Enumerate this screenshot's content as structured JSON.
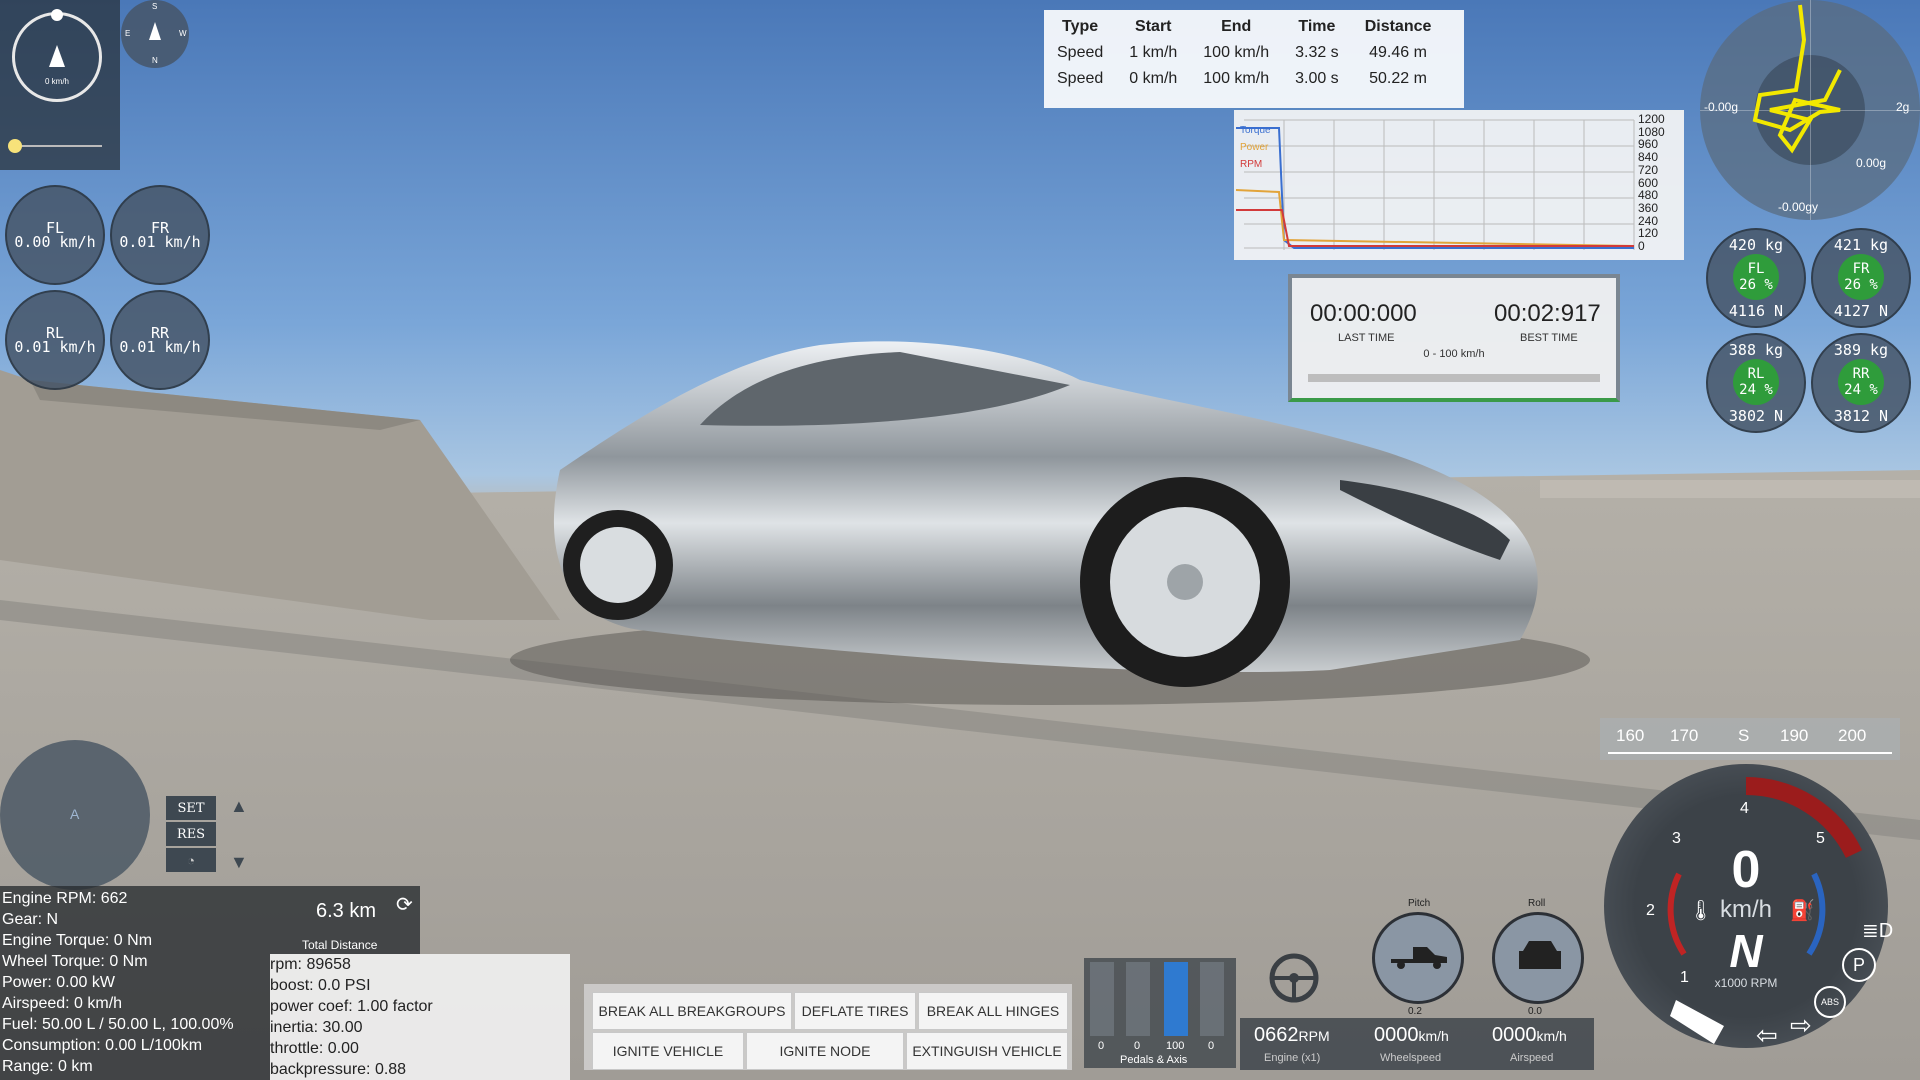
{
  "minimap": {
    "speed_label": "0 km/h",
    "compass": {
      "s": "S",
      "e": "E",
      "w": "W",
      "n": "N"
    }
  },
  "wheels": [
    {
      "name": "FL",
      "speed": "0.00 km/h"
    },
    {
      "name": "FR",
      "speed": "0.01 km/h"
    },
    {
      "name": "RL",
      "speed": "0.01 km/h"
    },
    {
      "name": "RR",
      "speed": "0.01 km/h"
    }
  ],
  "accel_table": {
    "headers": [
      "Type",
      "Start",
      "End",
      "Time",
      "Distance"
    ],
    "rows": [
      [
        "Speed",
        "1 km/h",
        "100 km/h",
        "3.32 s",
        "49.46 m"
      ],
      [
        "Speed",
        "0 km/h",
        "100 km/h",
        "3.00 s",
        "50.22 m"
      ]
    ]
  },
  "torque_graph": {
    "legend": [
      "Torque",
      "Power",
      "RPM"
    ],
    "legend_colors": [
      "#3a6fd0",
      "#e2a43a",
      "#d23a3a"
    ],
    "y_ticks": [
      "1200",
      "1080",
      "960",
      "840",
      "720",
      "600",
      "480",
      "360",
      "240",
      "120",
      "0"
    ]
  },
  "timer": {
    "last_time": "00:00:000",
    "last_label": "LAST TIME",
    "best_time": "00:02:917",
    "best_label": "BEST TIME",
    "range": "0 - 100 km/h"
  },
  "gforce": {
    "left": "-0.00g",
    "right": "2g",
    "inner_right": "0.00g",
    "bottom": "-0.00gy"
  },
  "tire_loads": [
    {
      "corner": "FL",
      "kg": "420 kg",
      "pct": "26 %",
      "n": "4116 N"
    },
    {
      "corner": "FR",
      "kg": "421 kg",
      "pct": "26 %",
      "n": "4127 N"
    },
    {
      "corner": "RL",
      "kg": "388 kg",
      "pct": "24 %",
      "n": "3802 N"
    },
    {
      "corner": "RR",
      "kg": "389 kg",
      "pct": "24 %",
      "n": "3812 N"
    }
  ],
  "cruise": {
    "set": "SET",
    "res": "RES"
  },
  "radar": {
    "label": "A"
  },
  "vehicle_info": {
    "lines": [
      "Engine RPM: 662",
      "Gear: N",
      "Engine Torque: 0 Nm",
      "Wheel Torque: 0 Nm",
      "Power: 0.00 kW",
      "Airspeed: 0 km/h",
      "Fuel: 50.00 L / 50.00 L, 100.00%",
      "Consumption: 0.00 L/100km",
      "Range: 0 km"
    ],
    "distance": "6.3 km",
    "distance_label": "Total Distance"
  },
  "engine_debug": [
    "rpm: 89658",
    "boost: 0.0 PSI",
    "power coef: 1.00 factor",
    "inertia: 30.00",
    "throttle: 0.00",
    "backpressure: 0.88"
  ],
  "buttons": {
    "break_groups": "BREAK ALL BREAKGROUPS",
    "deflate": "DEFLATE TIRES",
    "break_hinges": "BREAK ALL HINGES",
    "ignite_vehicle": "IGNITE VEHICLE",
    "ignite_node": "IGNITE NODE",
    "extinguish": "EXTINGUISH VEHICLE"
  },
  "pedals": {
    "values": [
      "0",
      "0",
      "100",
      "0"
    ],
    "label": "Pedals & Axis",
    "levels": [
      0,
      0,
      1,
      0
    ]
  },
  "readouts": {
    "rpm_value": "0662",
    "rpm_unit": "RPM",
    "rpm_label": "Engine (x1)",
    "wheel_value": "0000",
    "wheel_unit": "km/h",
    "wheel_label": "Wheelspeed",
    "air_value": "0000",
    "air_unit": "km/h",
    "air_label": "Airspeed"
  },
  "attitude": {
    "pitch_label": "Pitch",
    "roll_label": "Roll",
    "pitch_value": "0.2",
    "roll_value": "0.0"
  },
  "speed_tape": {
    "ticks": [
      "160",
      "170",
      "S",
      "190",
      "200"
    ]
  },
  "dashboard": {
    "speed": "0",
    "unit": "km/h",
    "gear": "N",
    "rpm_label": "x1000 RPM",
    "rpm_marks": [
      "1",
      "2",
      "3",
      "4",
      "5"
    ],
    "p_label": "P",
    "abs_label": "ABS"
  }
}
